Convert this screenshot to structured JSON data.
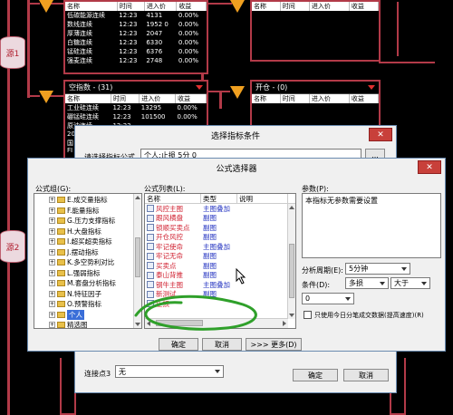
{
  "canvas": {
    "source1_label": "源1",
    "source2_label": "源2",
    "top_left_panel": {
      "columns": [
        "名称",
        "时间",
        "进入价",
        "收益"
      ],
      "rows": [
        [
          "低碳能源连续",
          "12:23",
          "4131",
          "0.00%"
        ],
        [
          "数线连续",
          "12:23",
          "1952 0",
          "0.00%"
        ],
        [
          "厚薄连续",
          "12:23",
          "2047",
          "0.00%"
        ],
        [
          "白糖连续",
          "12:23",
          "6330",
          "0.00%"
        ],
        [
          "锰硅连续",
          "12:23",
          "6376",
          "0.00%"
        ],
        [
          "强麦连续",
          "12:23",
          "2748",
          "0.00%"
        ]
      ]
    },
    "top_right_panel": {
      "columns": [
        "名称",
        "时间",
        "进入价",
        "收益"
      ]
    },
    "mid_left_panel": {
      "title": "空指数 - (31)",
      "columns": [
        "名称",
        "时间",
        "进入价",
        "收益"
      ],
      "rows": [
        [
          "工业硅连续",
          "12:23",
          "13295",
          "0.00%"
        ],
        [
          "硼锰硅连续",
          "12:23",
          "101500",
          "0.00%"
        ],
        [
          "原油连续",
          "12:23",
          "",
          ""
        ]
      ],
      "extra_rows": [
        "20",
        "国",
        "FI"
      ]
    },
    "mid_right_panel": {
      "title": "开仓 - (0)",
      "columns": [
        "名称",
        "时间",
        "进入价",
        "收益"
      ]
    }
  },
  "indicator_dialog": {
    "title": "选择指标条件",
    "close_label": "✕",
    "formula_label": "请选择指标公式",
    "formula_value": "个人:止损 5分 0",
    "ellipsis_label": "...",
    "connector_label": "连接点3",
    "connector_value": "无",
    "ok_label": "确定",
    "cancel_label": "取消"
  },
  "formula_dialog": {
    "title": "公式选择器",
    "close_label": "✕",
    "group_label": "公式组(G):",
    "list_label": "公式列表(L):",
    "param_label": "参数(P):",
    "param_text": "本指标无参数需要设置",
    "groups": [
      {
        "label": "E.成交量指标"
      },
      {
        "label": "F.能量指标"
      },
      {
        "label": "G.压力支撑指标"
      },
      {
        "label": "H.大盘指标"
      },
      {
        "label": "I.超买超卖指标"
      },
      {
        "label": "J.摆动指标"
      },
      {
        "label": "K.多空势利对比"
      },
      {
        "label": "L.强弱指标"
      },
      {
        "label": "M.套盘分析指标"
      },
      {
        "label": "N.特征因子"
      },
      {
        "label": "O.预警指标"
      },
      {
        "label": "个人",
        "selected": true
      },
      {
        "label": "精选图"
      }
    ],
    "list_columns": [
      "名称",
      "类型",
      "说明"
    ],
    "formulas": [
      {
        "name": "风控主图",
        "type": "主图叠加"
      },
      {
        "name": "跟风横盘",
        "type": "副图"
      },
      {
        "name": "锁顺买卖点",
        "type": "副图"
      },
      {
        "name": "开仓风控",
        "type": "副图"
      },
      {
        "name": "牢记使命",
        "type": "主图叠加"
      },
      {
        "name": "牢记无命",
        "type": "副图"
      },
      {
        "name": "买卖点",
        "type": "副图"
      },
      {
        "name": "泰山背推",
        "type": "副图"
      },
      {
        "name": "钢牛主图",
        "type": "主图叠加"
      },
      {
        "name": "新测试",
        "type": "副图"
      },
      {
        "name": "止损",
        "type": ""
      }
    ],
    "period_label": "分析周期(E):",
    "period_value": "5分钟",
    "condition_label": "条件(D):",
    "condition_value1": "多损",
    "condition_value2": "大于",
    "condition_value3": "0",
    "checkbox_label": "只使用今日分笔成交数据(提高速度)(R)",
    "ok_label": "确定",
    "cancel_label": "取消",
    "more_label": ">>> 更多(D)"
  },
  "colors": {
    "canvas_bg": "#000000",
    "flow_red": "#b23a48",
    "selected_blue": "#3a6ed8",
    "annotation_green": "#2fa02a"
  }
}
